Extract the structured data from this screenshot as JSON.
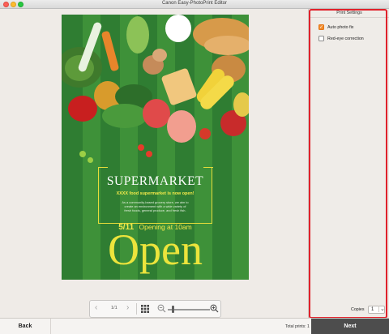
{
  "window": {
    "title": "Canon Easy-PhotoPrint Editor"
  },
  "poster": {
    "title": "SUPERMARKET",
    "subtitle": "XXXX food supermarket is now open!",
    "body_lines": [
      "As a community-based grocery store, we aim to",
      "create an environment with a wide variety of",
      "fresh foods, general produce, and fresh fish."
    ],
    "date": "5/11",
    "time": "Opening at 10am",
    "headline": "Open"
  },
  "page_toolbar": {
    "prev_icon": "chevron-left-icon",
    "page_indicator": "1/1",
    "next_icon": "chevron-right-icon",
    "grid_icon": "grid-icon",
    "zoom_out_icon": "zoom-out-icon",
    "zoom_in_icon": "zoom-in-icon",
    "zoom_level": 0.1
  },
  "print_settings": {
    "header": "Print Settings",
    "options": [
      {
        "label": "Auto photo fix",
        "checked": true
      },
      {
        "label": "Red-eye correction",
        "checked": false
      }
    ],
    "copies_label": "Copies",
    "copies_value": "1"
  },
  "footer": {
    "back_label": "Back",
    "total_prints": "Total prints: 1",
    "next_label": "Next"
  },
  "colors": {
    "accent_checkbox": "#f18b2a",
    "highlight_outline": "#e0212b",
    "next_button": "#4d4d4d",
    "poster_green": "#2f7d32"
  }
}
